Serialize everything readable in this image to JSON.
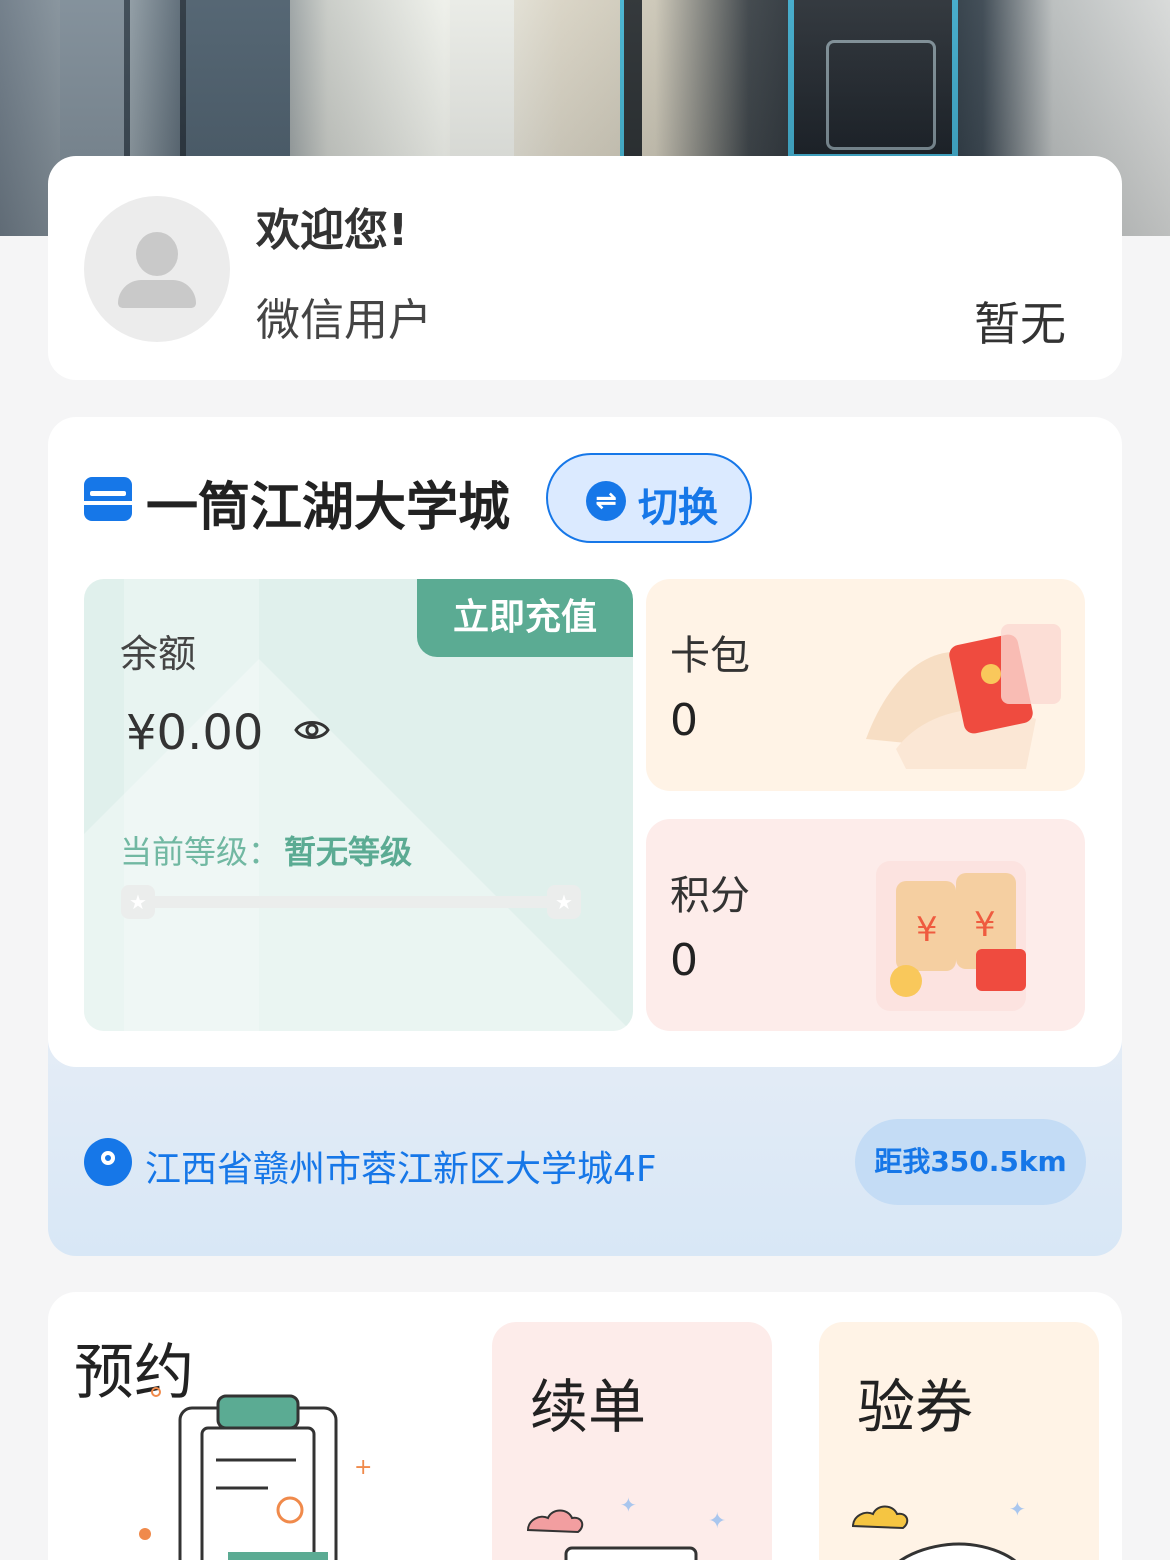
{
  "profile": {
    "welcome": "欢迎您!",
    "username": "微信用户",
    "member_level": "暂无"
  },
  "store": {
    "name": "一筒江湖大学城",
    "switch_label": "切换",
    "address": "江西省赣州市蓉江新区大学城4F",
    "distance": "距我350.5km"
  },
  "balance": {
    "label": "余额",
    "amount": "¥0.00",
    "recharge_label": "立即充值",
    "level_label": "当前等级：",
    "level_value": "暂无等级",
    "level_progress": 0
  },
  "wallet": {
    "cards_label": "卡包",
    "cards_count": "0",
    "points_label": "积分",
    "points_count": "0"
  },
  "services": {
    "booking": "预约",
    "renew": "续单",
    "voucher": "验券"
  },
  "colors": {
    "primary": "#1677e8",
    "recharge": "#5bab93",
    "balance_bg": "#e0f0ec"
  }
}
